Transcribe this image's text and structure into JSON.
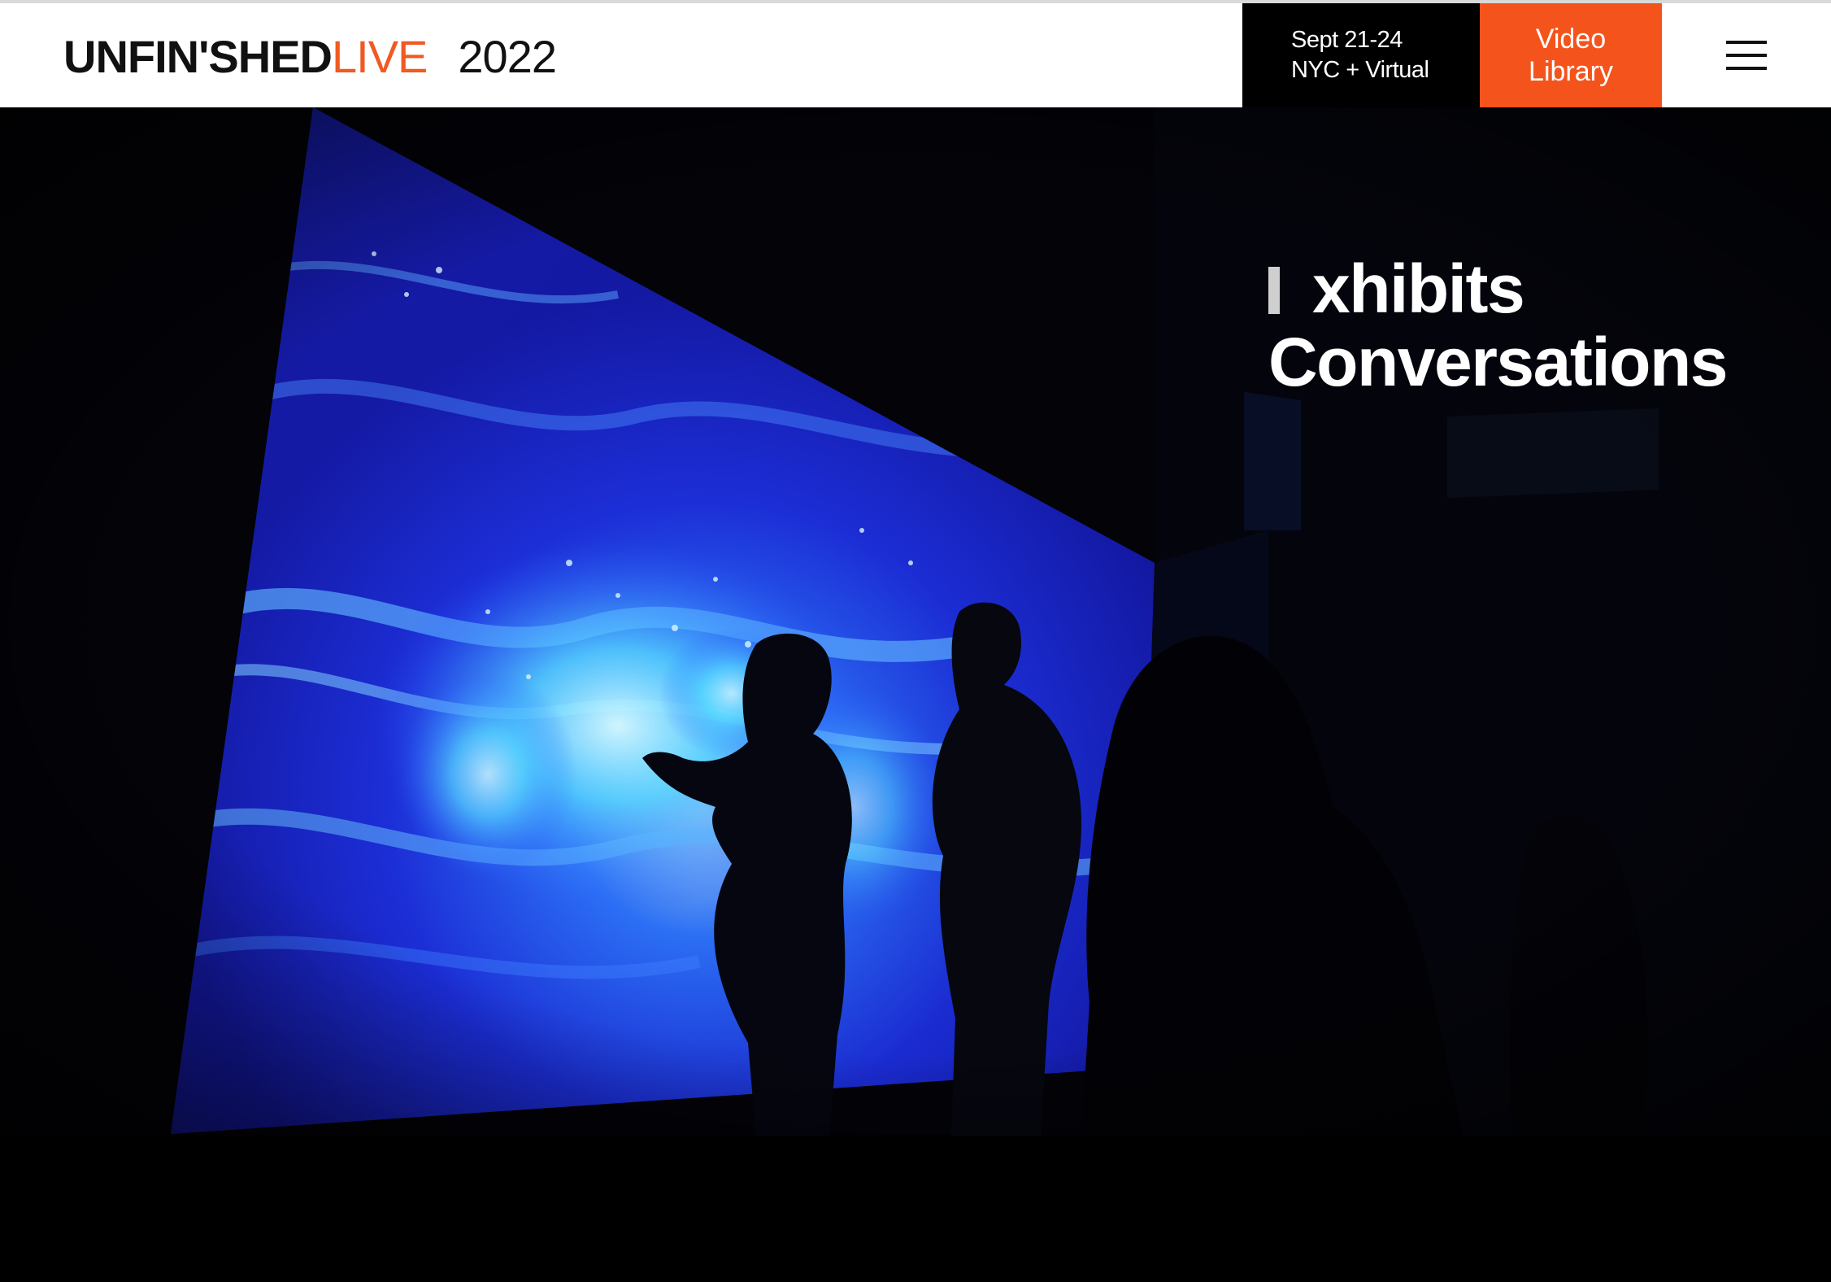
{
  "header": {
    "logo": {
      "brand_main": "UNFIN'SHED",
      "brand_live": "LIVE",
      "year": "2022"
    },
    "event_dates": "Sept 21-24",
    "event_location": "NYC + Virtual",
    "video_library": {
      "line1": "Video",
      "line2": "Library"
    },
    "menu_icon": "hamburger-menu-icon"
  },
  "hero": {
    "typing_line": "xhibits",
    "second_line": "Conversations",
    "image_description_icon": "video-still"
  },
  "colors": {
    "accent": "#f4541c",
    "brand_live": "#f05a22",
    "header_bg": "#ffffff",
    "event_bg": "#000000",
    "hero_bg": "#030308"
  }
}
